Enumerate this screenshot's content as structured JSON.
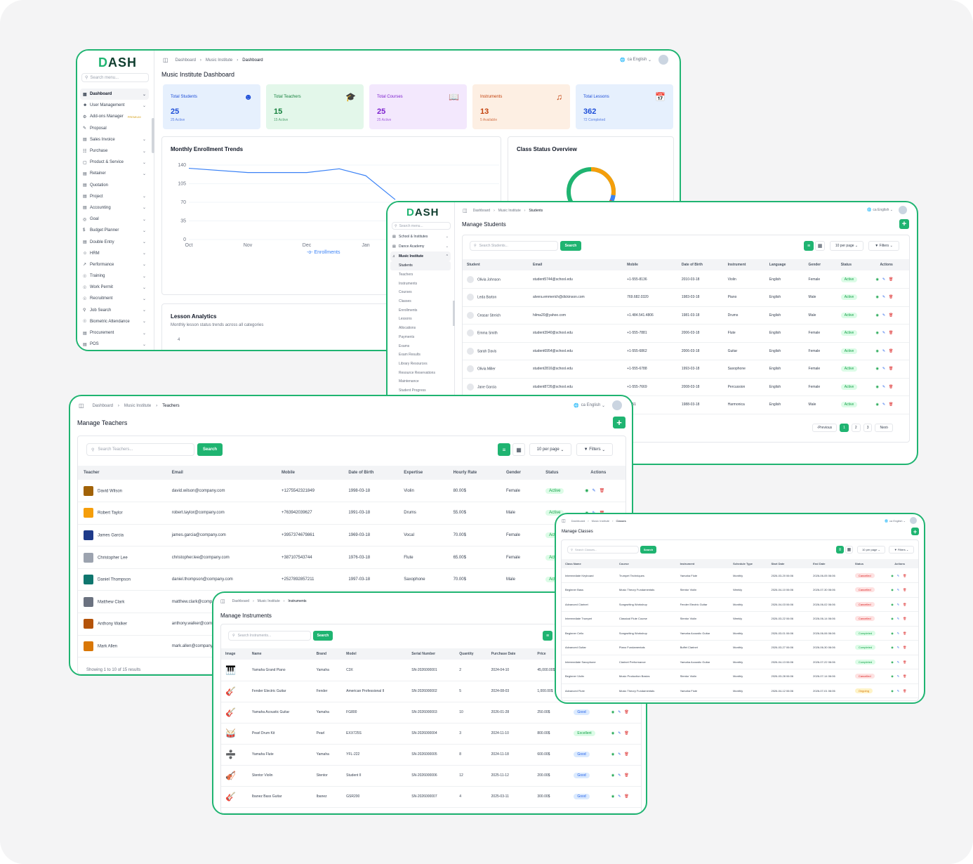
{
  "dashboard": {
    "logo": "DASH",
    "search_placeholder": "Search menu...",
    "breadcrumb": [
      "Dashboard",
      "Music Institute",
      "Dashboard"
    ],
    "lang": "English",
    "lang_code": "ca",
    "title": "Music Institute Dashboard",
    "menu": [
      {
        "label": "Dashboard",
        "chev": true,
        "active": true
      },
      {
        "label": "User Management",
        "chev": true
      },
      {
        "label": "Add-ons Manager",
        "badge": "PREMIUM"
      },
      {
        "label": "Proposal"
      },
      {
        "label": "Sales Invoice",
        "chev": true
      },
      {
        "label": "Purchase",
        "chev": true
      },
      {
        "label": "Product & Service",
        "chev": true
      },
      {
        "label": "Retainer",
        "chev": true
      },
      {
        "label": "Quotation"
      },
      {
        "label": "Project",
        "chev": true
      },
      {
        "label": "Accounting",
        "chev": true
      },
      {
        "label": "Goal",
        "chev": true
      },
      {
        "label": "Budget Planner",
        "chev": true
      },
      {
        "label": "Double Entry",
        "chev": true
      },
      {
        "label": "HRM",
        "chev": true
      },
      {
        "label": "Performance",
        "chev": true
      },
      {
        "label": "Training",
        "chev": true
      },
      {
        "label": "Work Permit",
        "chev": true
      },
      {
        "label": "Recruitment",
        "chev": true
      },
      {
        "label": "Job Search",
        "chev": true
      },
      {
        "label": "Biometric Attendance",
        "chev": true
      },
      {
        "label": "Procurement",
        "chev": true
      },
      {
        "label": "POS",
        "chev": true
      }
    ],
    "stats": [
      {
        "label": "Total Students",
        "value": "25",
        "sub": "25 Active",
        "bg": "#e6f0fd",
        "fg": "#1d4ed8"
      },
      {
        "label": "Total Teachers",
        "value": "15",
        "sub": "15 Active",
        "bg": "#e3f7ea",
        "fg": "#15803d"
      },
      {
        "label": "Total Courses",
        "value": "25",
        "sub": "25 Active",
        "bg": "#f3e8fd",
        "fg": "#7e22ce"
      },
      {
        "label": "Instruments",
        "value": "13",
        "sub": "5 Available",
        "bg": "#fdefe3",
        "fg": "#c2410c"
      },
      {
        "label": "Total Lessons",
        "value": "362",
        "sub": "72 Completed",
        "bg": "#e6f0fd",
        "fg": "#1d4ed8"
      }
    ],
    "enrollment_title": "Monthly Enrollment Trends",
    "class_status_title": "Class Status Overview",
    "lesson_title": "Lesson Analytics",
    "lesson_sub": "Monthly lesson status trends across all categories",
    "lesson_tick": "4"
  },
  "chart_data": {
    "type": "line",
    "title": "Monthly Enrollment Trends",
    "categories": [
      "Oct",
      "Nov",
      "Dec",
      "Jan"
    ],
    "yticks": [
      "140",
      "105",
      "70",
      "35",
      "0"
    ],
    "ylim": [
      0,
      140
    ],
    "series": [
      {
        "name": "Enrollments",
        "color": "#3b82f6",
        "points": [
          [
            0,
            134
          ],
          [
            1,
            126
          ],
          [
            2,
            126
          ],
          [
            2.55,
            133
          ],
          [
            3,
            120
          ],
          [
            3.5,
            75
          ]
        ]
      }
    ],
    "legend": "Enrollments"
  },
  "students": {
    "logo": "DASH",
    "search_placeholder": "Search menu...",
    "breadcrumb": [
      "Dashboard",
      "Music Institute",
      "Students"
    ],
    "lang": "English",
    "lang_code": "ca",
    "menu": [
      {
        "label": "School & Institutes",
        "chev": true
      },
      {
        "label": "Dance Academy",
        "chev": true
      },
      {
        "label": "Music Institute",
        "chev": true,
        "open": true
      }
    ],
    "submenu": [
      "Students",
      "Teachers",
      "Instruments",
      "Courses",
      "Classes",
      "Enrollments",
      "Lessons",
      "Allocations",
      "Payments",
      "Exams",
      "Exam Results",
      "Library Resources",
      "Resource Reservations",
      "Maintenance",
      "Student Progress"
    ],
    "title": "Manage Students",
    "search_placeholder2": "Search Students...",
    "search_btn": "Search",
    "per_page": "10 per page",
    "filters": "Filters",
    "columns": [
      "Student",
      "Email",
      "Mobile",
      "Date of Birth",
      "Instrument",
      "Language",
      "Gender",
      "Status",
      "Actions"
    ],
    "rows": [
      [
        "Olivia Johnson",
        "student5744@school.edu",
        "+1-555-8136",
        "2010-03-18",
        "Violin",
        "English",
        "Female",
        "Active"
      ],
      [
        "Leda Barton",
        "alvera.emmerich@dickinson.com",
        "769.682.0320",
        "1983-03-18",
        "Piano",
        "English",
        "Male",
        "Active"
      ],
      [
        "Ceasar Streich",
        "hilma20@yahoo.com",
        "+1.484.541.4806",
        "1981-03-18",
        "Drums",
        "English",
        "Male",
        "Active"
      ],
      [
        "Emma Smith",
        "student3940@school.edu",
        "+1-555-7881",
        "2006-03-18",
        "Flute",
        "English",
        "Female",
        "Active"
      ],
      [
        "Sarah Davis",
        "student6954@school.edu",
        "+1-555-6862",
        "2006-03-18",
        "Guitar",
        "English",
        "Female",
        "Active"
      ],
      [
        "Olivia Miller",
        "student2816@school.edu",
        "+1-555-6788",
        "1993-03-18",
        "Saxophone",
        "English",
        "Female",
        "Active"
      ],
      [
        "Jane Garcia",
        "student8726@school.edu",
        "+1-555-7669",
        "2008-03-18",
        "Percussion",
        "English",
        "Female",
        "Active"
      ],
      [
        "",
        "",
        "-2351",
        "1988-03-18",
        "Harmonica",
        "English",
        "Male",
        "Active"
      ]
    ],
    "pagination": [
      "Previous",
      "1",
      "2",
      "3",
      "Next"
    ]
  },
  "teachers": {
    "breadcrumb": [
      "Dashboard",
      "Music Institute",
      "Teachers"
    ],
    "lang": "English",
    "lang_code": "ca",
    "title": "Manage Teachers",
    "search_placeholder": "Search Teachers...",
    "search_btn": "Search",
    "per_page": "10 per page",
    "filters": "Filters",
    "columns": [
      "Teacher",
      "Email",
      "Mobile",
      "Date of Birth",
      "Expertise",
      "Hourly Rate",
      "Gender",
      "Status",
      "Actions"
    ],
    "rows": [
      [
        "David Wilson",
        "david.wilson@company.com",
        "+1275542321849",
        "1998-03-18",
        "Violin",
        "80.00$",
        "Female",
        "Active"
      ],
      [
        "Robert Taylor",
        "robert.taylor@company.com",
        "+76394203962​7",
        "1991-03-18",
        "Drums",
        "55.00$",
        "Male",
        "Active"
      ],
      [
        "James Garcia",
        "james.garcia@company.com",
        "+3957374679861",
        "1969-03-18",
        "Vocal",
        "70.00$",
        "Female",
        "Active"
      ],
      [
        "Christopher Lee",
        "christopher.lee@company.com",
        "+387107543744",
        "1976-03-18",
        "Flute",
        "65.00$",
        "Female",
        "Active"
      ],
      [
        "Daniel Thompson",
        "daniel.thompson@company.com",
        "+2527892857211",
        "1997-03-18",
        "Saxophone",
        "70.00$",
        "Male",
        "Active"
      ],
      [
        "Matthew Clark",
        "matthew.clark@comp",
        "",
        "",
        "",
        "",
        "",
        ""
      ],
      [
        "Anthony Walker",
        "anthony.walker@com",
        "",
        "",
        "",
        "",
        "",
        ""
      ],
      [
        "Mark Allen",
        "mark.allen@company",
        "",
        "",
        "",
        "",
        "",
        ""
      ]
    ],
    "footer": "Showing 1 to 10 of 15 results"
  },
  "instruments": {
    "breadcrumb": [
      "Dashboard",
      "Music Institute",
      "Instruments"
    ],
    "title": "Manage Instruments",
    "search_placeholder": "Search Instruments...",
    "search_btn": "Search",
    "columns": [
      "Image",
      "Name",
      "Brand",
      "Model",
      "Serial Number",
      "Quantity",
      "Purchase Date",
      "Price"
    ],
    "rows": [
      [
        "Yamaha Grand Piano",
        "Yamaha",
        "C3X",
        "SN-2026000001",
        "2",
        "2024-04-10",
        "45,000.00$",
        ""
      ],
      [
        "Fender Electric Guitar",
        "Fender",
        "American Professional II",
        "SN-2026000002",
        "5",
        "2024-08-03",
        "1,000.00$",
        ""
      ],
      [
        "Yamaha Acoustic Guitar",
        "Yamaha",
        "FG800",
        "SN-2026000003",
        "10",
        "2026-01-28",
        "250.00$",
        "Good"
      ],
      [
        "Pearl Drum Kit",
        "Pearl",
        "EXX725S",
        "SN-2026000004",
        "3",
        "2024-11-10",
        "800.00$",
        "Excellent"
      ],
      [
        "Yamaha Flute",
        "Yamaha",
        "YFL-222",
        "SN-2026000005",
        "8",
        "2024-11-18",
        "600.00$",
        "Good"
      ],
      [
        "Stentor Violin",
        "Stentor",
        "Student II",
        "SN-2026000006",
        "12",
        "2025-11-12",
        "200.00$",
        "Good"
      ],
      [
        "Ibanez Bass Guitar",
        "Ibanez",
        "GSR200",
        "SN-2026000007",
        "4",
        "2025-03-11",
        "300.00$",
        "Good"
      ]
    ]
  },
  "classes": {
    "breadcrumb": [
      "Dashboard",
      "Music Institute",
      "Classes"
    ],
    "lang": "English",
    "lang_code": "ca",
    "title": "Manage Classes",
    "search_placeholder": "Search Classes...",
    "search_btn": "Search",
    "per_page": "10 per page",
    "filters": "Filters",
    "columns": [
      "Class Name",
      "Course",
      "Instrument",
      "Schedule Type",
      "Start Date",
      "End Date",
      "Status",
      "Actions"
    ],
    "rows": [
      [
        "Intermediate Keyboard",
        "Trumpet Techniques",
        "Yamaha Flute",
        "Monthly",
        "2026-03-20 06:06",
        "2026-06-05 06:06",
        "Cancelled"
      ],
      [
        "Beginner Bass",
        "Music Theory Fundamentals",
        "Stentor Violin",
        "Weekly",
        "2026-04-10 06:06",
        "2026-07-30 06:06",
        "Cancelled"
      ],
      [
        "Advanced Clarinet",
        "Songwriting Workshop",
        "Fender Electric Guitar",
        "Monthly",
        "2026-04-03 06:06",
        "2026-06-02 06:06",
        "Cancelled"
      ],
      [
        "Intermediate Trumpet",
        "Classical Flute Course",
        "Stentor Violin",
        "Weekly",
        "2026-03-22 06:06",
        "2026-06-14 06:06",
        "Cancelled"
      ],
      [
        "Beginner Cello",
        "Songwriting Workshop",
        "Yamaha Acoustic Guitar",
        "Monthly",
        "2026-03-01 06:06",
        "2026-06-06 06:06",
        "Completed"
      ],
      [
        "Advanced Guitar",
        "Piano Fundamentals",
        "Buffet Clarinet",
        "Monthly",
        "2026-03-27 06:06",
        "2026-06-30 06:06",
        "Completed"
      ],
      [
        "Intermediate Saxophone",
        "Clarinet Performance",
        "Yamaha Acoustic Guitar",
        "Monthly",
        "2026-04-13 06:06",
        "2026-07-22 06:06",
        "Completed"
      ],
      [
        "Beginner Violin",
        "Music Production Basics",
        "Stentor Violin",
        "Monthly",
        "2026-03-28 06:06",
        "2026-07-14 06:06",
        "Cancelled"
      ],
      [
        "Advanced Flute",
        "Music Theory Fundamentals",
        "Yamaha Flute",
        "Monthly",
        "2026-04-12 06:06",
        "2026-07-01 06:06",
        "Ongoing"
      ]
    ]
  },
  "colors": {
    "accent": "#1fb471",
    "donut": [
      "#f59e0b",
      "#1fb471",
      "#3b82f6",
      "#ef4444"
    ]
  }
}
